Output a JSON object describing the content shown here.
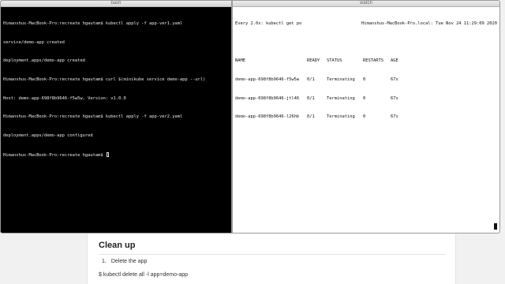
{
  "terminal_left": {
    "title": "bash",
    "lines": [
      "Himanshus-MacBook-Pro:recreate hgautam$ kubectl apply -f app-ver1.yaml",
      "service/demo-app created",
      "deployment.apps/demo-app created",
      "Himanshus-MacBook-Pro:recreate hgautam$ curl $(minikube service demo-app --url)",
      "Host: demo-app-698f8b9646-f5w5w, Version: v1.0.0",
      "Himanshus-MacBook-Pro:recreate hgautam$ kubectl apply -f app-ver2.yaml",
      "deployment.apps/demo-app configured",
      "Himanshus-MacBook-Pro:recreate hgautam$ "
    ]
  },
  "terminal_right": {
    "title": "watch",
    "header_left": "Every 2.0s: kubectl get po",
    "header_right": "Himanshus-MacBook-Pro.local: Tue Nov 24 11:29:09 2020",
    "columns": [
      "NAME",
      "READY",
      "STATUS",
      "RESTARTS",
      "AGE"
    ],
    "rows": [
      [
        "demo-app-698f8b9646-f5w5w",
        "0/1",
        "Terminating",
        "0",
        "67s"
      ],
      [
        "demo-app-698f8b9646-jtl46",
        "0/1",
        "Terminating",
        "0",
        "67s"
      ],
      [
        "demo-app-698f8b9646-l26hb",
        "0/1",
        "Terminating",
        "0",
        "67s"
      ]
    ]
  },
  "doc": {
    "heading": "Clean up",
    "step_number": "1.",
    "step_text": "Delete the app",
    "command": "$ kubectl delete all -l app=demo-app"
  }
}
